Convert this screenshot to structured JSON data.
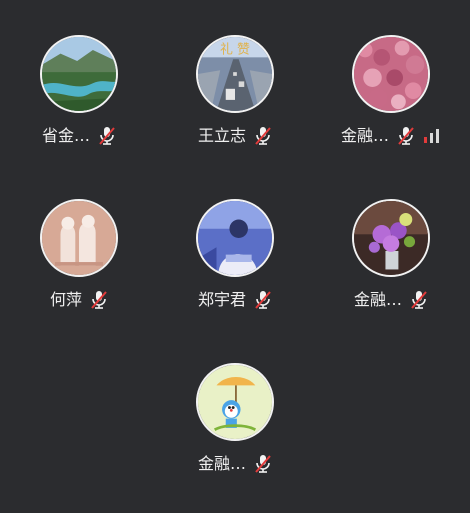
{
  "participants": [
    {
      "name": "省金…",
      "avatar": "landscape-river-avatar",
      "muted": true,
      "signal": false
    },
    {
      "name": "王立志",
      "avatar": "highway-city-avatar",
      "muted": true,
      "signal": false
    },
    {
      "name": "金融…",
      "avatar": "pink-petals-avatar",
      "muted": true,
      "signal": true
    },
    {
      "name": "何萍",
      "avatar": "sketch-couple-avatar",
      "muted": true,
      "signal": false
    },
    {
      "name": "郑宇君",
      "avatar": "blue-portrait-avatar",
      "muted": true,
      "signal": false
    },
    {
      "name": "金融…",
      "avatar": "flowers-vase-avatar",
      "muted": true,
      "signal": false
    },
    {
      "name": "金融…",
      "avatar": "cartoon-umbrella-avatar",
      "muted": true,
      "signal": false
    }
  ],
  "colors": {
    "background": "#2b2c2f",
    "mute_red": "#e23b3b",
    "text": "#f0f0f0"
  }
}
